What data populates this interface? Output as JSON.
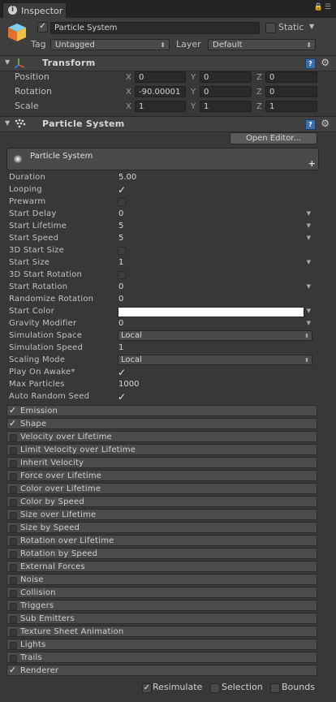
{
  "tab": {
    "info_icon": "info-icon",
    "title": "Inspector"
  },
  "header": {
    "object_name": "Particle System",
    "active": true,
    "static_label": "Static",
    "static_checked": false,
    "tag_label": "Tag",
    "tag_value": "Untagged",
    "layer_label": "Layer",
    "layer_value": "Default"
  },
  "transform": {
    "title": "Transform",
    "rows": [
      {
        "label": "Position",
        "x": "0",
        "y": "0",
        "z": "0"
      },
      {
        "label": "Rotation",
        "x": "-90.00001",
        "y": "0",
        "z": "0"
      },
      {
        "label": "Scale",
        "x": "1",
        "y": "1",
        "z": "1"
      }
    ],
    "axis": {
      "x": "X",
      "y": "Y",
      "z": "Z"
    }
  },
  "particle_system": {
    "title": "Particle System",
    "open_editor": "Open Editor...",
    "main_module": "Particle System",
    "main_module_plus": "+",
    "properties": [
      {
        "label": "Duration",
        "value": "5.00",
        "kind": "text"
      },
      {
        "label": "Looping",
        "value": "✓",
        "kind": "check"
      },
      {
        "label": "Prewarm",
        "value": "",
        "kind": "box"
      },
      {
        "label": "Start Delay",
        "value": "0",
        "kind": "curve"
      },
      {
        "label": "Start Lifetime",
        "value": "5",
        "kind": "curve"
      },
      {
        "label": "Start Speed",
        "value": "5",
        "kind": "curve"
      },
      {
        "label": "3D Start Size",
        "value": "",
        "kind": "box"
      },
      {
        "label": "Start Size",
        "value": "1",
        "kind": "curve"
      },
      {
        "label": "3D Start Rotation",
        "value": "",
        "kind": "box"
      },
      {
        "label": "Start Rotation",
        "value": "0",
        "kind": "curve"
      },
      {
        "label": "Randomize Rotation",
        "value": "0",
        "kind": "text"
      },
      {
        "label": "Start Color",
        "value": "",
        "kind": "color"
      },
      {
        "label": "Gravity Modifier",
        "value": "0",
        "kind": "curve"
      },
      {
        "label": "Simulation Space",
        "value": "Local",
        "kind": "dropdown"
      },
      {
        "label": "Simulation Speed",
        "value": "1",
        "kind": "text"
      },
      {
        "label": "Scaling Mode",
        "value": "Local",
        "kind": "dropdown"
      },
      {
        "label": "Play On Awake*",
        "value": "✓",
        "kind": "check"
      },
      {
        "label": "Max Particles",
        "value": "1000",
        "kind": "text"
      },
      {
        "label": "Auto Random Seed",
        "value": "✓",
        "kind": "check"
      }
    ],
    "modules": [
      {
        "label": "Emission",
        "checked": true
      },
      {
        "label": "Shape",
        "checked": true
      },
      {
        "label": "Velocity over Lifetime",
        "checked": false
      },
      {
        "label": "Limit Velocity over Lifetime",
        "checked": false
      },
      {
        "label": "Inherit Velocity",
        "checked": false
      },
      {
        "label": "Force over Lifetime",
        "checked": false
      },
      {
        "label": "Color over Lifetime",
        "checked": false
      },
      {
        "label": "Color by Speed",
        "checked": false
      },
      {
        "label": "Size over Lifetime",
        "checked": false
      },
      {
        "label": "Size by Speed",
        "checked": false
      },
      {
        "label": "Rotation over Lifetime",
        "checked": false
      },
      {
        "label": "Rotation by Speed",
        "checked": false
      },
      {
        "label": "External Forces",
        "checked": false
      },
      {
        "label": "Noise",
        "checked": false
      },
      {
        "label": "Collision",
        "checked": false
      },
      {
        "label": "Triggers",
        "checked": false
      },
      {
        "label": "Sub Emitters",
        "checked": false
      },
      {
        "label": "Texture Sheet Animation",
        "checked": false
      },
      {
        "label": "Lights",
        "checked": false
      },
      {
        "label": "Trails",
        "checked": false
      },
      {
        "label": "Renderer",
        "checked": true
      }
    ]
  },
  "footer": {
    "resimulate": "Resimulate",
    "resimulate_checked": true,
    "selection": "Selection",
    "selection_checked": false,
    "bounds": "Bounds",
    "bounds_checked": false
  },
  "colors": {
    "panel_bg": "#383838",
    "start_color": "#ffffff",
    "help_blue": "#3d6ea8"
  }
}
